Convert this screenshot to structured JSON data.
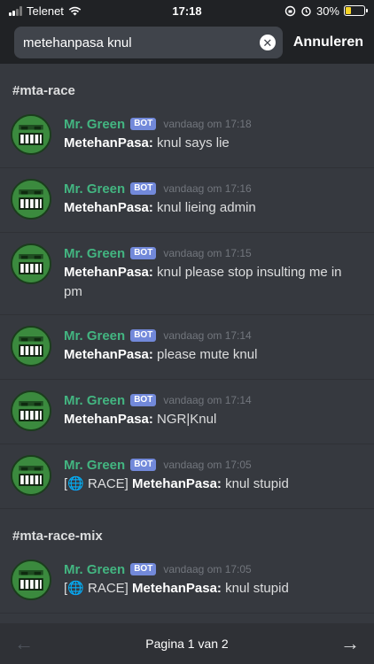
{
  "status": {
    "carrier": "Telenet",
    "time": "17:18",
    "battery": "30%",
    "battery_level": 0.3
  },
  "search": {
    "query": "metehanpasa knul",
    "cancel_label": "Annuleren"
  },
  "groups": [
    {
      "channel": "#mta-race",
      "messages": [
        {
          "author": "Mr. Green",
          "tag": "BOT",
          "time": "vandaag om 17:18",
          "prefix": "",
          "sender": "MetehanPasa:",
          "text": " knul says lie"
        },
        {
          "author": "Mr. Green",
          "tag": "BOT",
          "time": "vandaag om 17:16",
          "prefix": "",
          "sender": "MetehanPasa:",
          "text": " knul lieing admin"
        },
        {
          "author": "Mr. Green",
          "tag": "BOT",
          "time": "vandaag om 17:15",
          "prefix": "",
          "sender": "MetehanPasa:",
          "text": " knul please stop insulting me in pm"
        },
        {
          "author": "Mr. Green",
          "tag": "BOT",
          "time": "vandaag om 17:14",
          "prefix": "",
          "sender": "MetehanPasa:",
          "text": " please mute knul"
        },
        {
          "author": "Mr. Green",
          "tag": "BOT",
          "time": "vandaag om 17:14",
          "prefix": "",
          "sender": "MetehanPasa:",
          "text": " NGR|Knul"
        },
        {
          "author": "Mr. Green",
          "tag": "BOT",
          "time": "vandaag om 17:05",
          "prefix": "[🌐 RACE] ",
          "sender": "MetehanPasa:",
          "text": " knul stupid"
        }
      ]
    },
    {
      "channel": "#mta-race-mix",
      "messages": [
        {
          "author": "Mr. Green",
          "tag": "BOT",
          "time": "vandaag om 17:05",
          "prefix": "[🌐 RACE] ",
          "sender": "MetehanPasa:",
          "text": " knul stupid"
        }
      ]
    }
  ],
  "pager": {
    "label": "Pagina 1 van 2",
    "prev": "←",
    "next": "→"
  },
  "colors": {
    "author": "#43b581",
    "bot_tag": "#7289da",
    "background": "#36393f"
  }
}
